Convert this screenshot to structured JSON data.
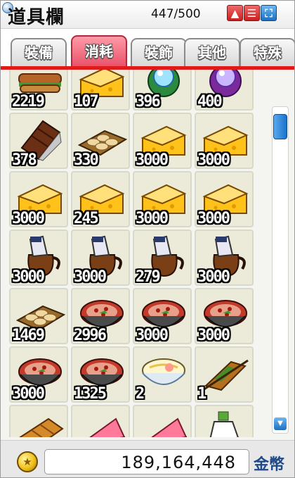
{
  "window": {
    "title": "道具欄",
    "capacity": "447/500",
    "buttons": {
      "sort_icon": "up-arrow-icon",
      "list_icon": "list-icon",
      "expand_icon": "expand-icon"
    }
  },
  "tabs": [
    {
      "label": "裝備",
      "active": false
    },
    {
      "label": "消耗",
      "active": true
    },
    {
      "label": "裝飾",
      "active": false
    },
    {
      "label": "其他",
      "active": false
    },
    {
      "label": "特殊",
      "active": false
    }
  ],
  "items": [
    {
      "icon": "sandwich",
      "qty": "2219"
    },
    {
      "icon": "cheese-wedge",
      "qty": "107"
    },
    {
      "icon": "blue-orb",
      "qty": "396"
    },
    {
      "icon": "purple-orb",
      "qty": "400"
    },
    {
      "icon": "chocolate-bar",
      "qty": "378"
    },
    {
      "icon": "dumplings-tray",
      "qty": "330"
    },
    {
      "icon": "cheese-wedge",
      "qty": "3000"
    },
    {
      "icon": "cheese-wedge",
      "qty": "3000"
    },
    {
      "icon": "cheese-wedge",
      "qty": "3000"
    },
    {
      "icon": "cheese-wedge",
      "qty": "245"
    },
    {
      "icon": "cheese-wedge",
      "qty": "3000"
    },
    {
      "icon": "cheese-wedge",
      "qty": "3000"
    },
    {
      "icon": "milk-jug",
      "qty": "3000"
    },
    {
      "icon": "milk-jug",
      "qty": "3000"
    },
    {
      "icon": "milk-jug",
      "qty": "279"
    },
    {
      "icon": "milk-jug",
      "qty": "3000"
    },
    {
      "icon": "dumplings-tray",
      "qty": "1469"
    },
    {
      "icon": "meat-bowl",
      "qty": "2996"
    },
    {
      "icon": "meat-bowl",
      "qty": "3000"
    },
    {
      "icon": "meat-bowl",
      "qty": "3000"
    },
    {
      "icon": "meat-bowl",
      "qty": "3000"
    },
    {
      "icon": "meat-bowl",
      "qty": "1325"
    },
    {
      "icon": "ramen-bowl",
      "qty": "2"
    },
    {
      "icon": "grilled-skewer",
      "qty": "1"
    },
    {
      "icon": "bread-loaf",
      "qty": ""
    },
    {
      "icon": "pink-cake-slice",
      "qty": ""
    },
    {
      "icon": "pink-cake-slice",
      "qty": ""
    },
    {
      "icon": "potion-bottle",
      "qty": ""
    }
  ],
  "footer": {
    "money": "189,164,448",
    "currency_label": "金幣",
    "coin_icon": "coin-icon"
  },
  "colors": {
    "active_tab": "#e8536a",
    "tab_underline": "#e01919",
    "scroll_accent": "#1b73c9",
    "currency_text": "#1f4a8a"
  }
}
